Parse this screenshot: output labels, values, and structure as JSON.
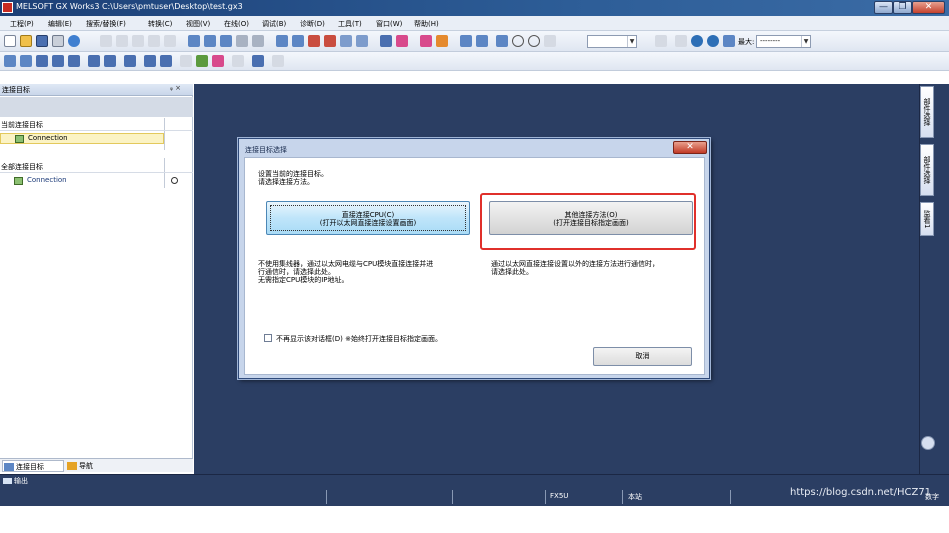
{
  "window": {
    "title": "MELSOFT GX Works3 C:\\Users\\pmtuser\\Desktop\\test.gx3",
    "min_label": "—",
    "max_label": "❐",
    "close_label": "✕"
  },
  "menu": [
    "工程(P)",
    "编辑(E)",
    "搜索/替换(F)",
    "转换(C)",
    "视图(V)",
    "在线(O)",
    "调试(B)",
    "诊断(D)",
    "工具(T)",
    "窗口(W)",
    "帮助(H)"
  ],
  "toolbar": {
    "zoom_combo": "",
    "max_label": "最大:",
    "max_value": "--------"
  },
  "left_pane": {
    "title": "连接目标",
    "pin": "ᵩ ×",
    "current_section": "当前连接目标",
    "current_item": "Connection",
    "all_section": "全部连接目标",
    "all_item": "Connection",
    "tabs": [
      "连接目标",
      "导航"
    ]
  },
  "right_tabs": [
    "部件选择",
    "部件选择",
    "监看1"
  ],
  "output": {
    "label": "输出"
  },
  "status": {
    "cpu": "FX5U",
    "station": "本站",
    "mode": "数字"
  },
  "watermark": "https://blog.csdn.net/HCZ71",
  "dialog": {
    "title": "连接目标选择",
    "close_label": "✕",
    "intro_line1": "设置当前的连接目标。",
    "intro_line2": "请选择连接方法。",
    "direct_button_line1": "直接连接CPU(C)",
    "direct_button_line2": "(打开以太网直接连接设置画面)",
    "other_button_line1": "其他连接方法(O)",
    "other_button_line2": "(打开连接目标指定画面)",
    "direct_desc_line1": "不使用集线器，通过以太网电缆与CPU模块直接连接并进",
    "direct_desc_line2": "行通信时，请选择此处。",
    "direct_desc_line3": "无需指定CPU模块的IP地址。",
    "other_desc_line1": "通过以太网直接连接设置以外的连接方法进行通信时，",
    "other_desc_line2": "请选择此处。",
    "checkbox_label": "不再显示该对话框(D) ※始终打开连接目标指定画面。",
    "cancel_label": "取消"
  }
}
